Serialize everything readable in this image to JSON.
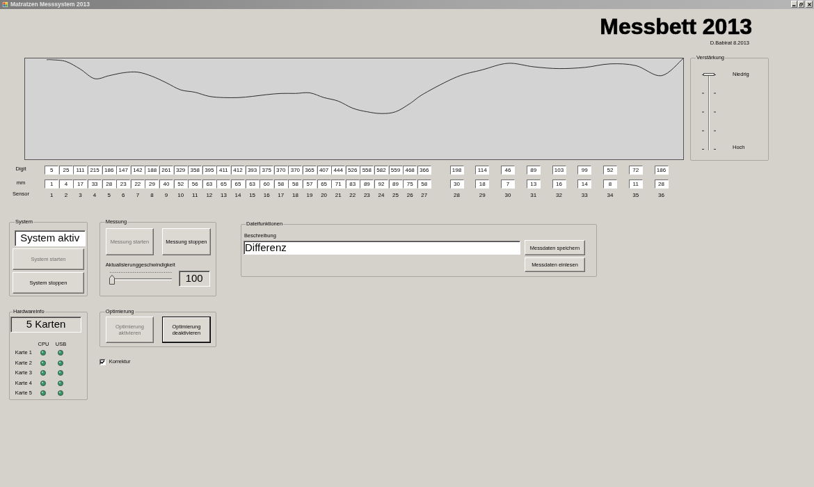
{
  "window": {
    "title": "Matratzen Messsystem 2013"
  },
  "header": {
    "title": "Messbett 2013",
    "subtitle": "D.Babirat 8.2013"
  },
  "gain": {
    "title": "Verstärkung",
    "level": 0,
    "top_label": "Niedrig",
    "bottom_label": "Hoch"
  },
  "sensor_table": {
    "row_labels": [
      "Digit",
      "mm",
      "Sensor"
    ],
    "groups": [
      {
        "kind": "dense",
        "sensors": [
          {
            "number": "1",
            "digit": "5",
            "mm": "1"
          },
          {
            "number": "2",
            "digit": "25",
            "mm": "4"
          },
          {
            "number": "3",
            "digit": "111",
            "mm": "17"
          },
          {
            "number": "4",
            "digit": "215",
            "mm": "33"
          },
          {
            "number": "5",
            "digit": "186",
            "mm": "28"
          },
          {
            "number": "6",
            "digit": "147",
            "mm": "23"
          },
          {
            "number": "7",
            "digit": "142",
            "mm": "22"
          },
          {
            "number": "8",
            "digit": "188",
            "mm": "29"
          },
          {
            "number": "9",
            "digit": "261",
            "mm": "40"
          },
          {
            "number": "10",
            "digit": "329",
            "mm": "52"
          },
          {
            "number": "11",
            "digit": "358",
            "mm": "56"
          },
          {
            "number": "12",
            "digit": "395",
            "mm": "63"
          },
          {
            "number": "13",
            "digit": "411",
            "mm": "65"
          },
          {
            "number": "14",
            "digit": "412",
            "mm": "65"
          },
          {
            "number": "15",
            "digit": "393",
            "mm": "63"
          },
          {
            "number": "16",
            "digit": "375",
            "mm": "60"
          },
          {
            "number": "17",
            "digit": "370",
            "mm": "58"
          },
          {
            "number": "18",
            "digit": "370",
            "mm": "58"
          },
          {
            "number": "19",
            "digit": "365",
            "mm": "57"
          },
          {
            "number": "20",
            "digit": "407",
            "mm": "65"
          },
          {
            "number": "21",
            "digit": "444",
            "mm": "71"
          },
          {
            "number": "22",
            "digit": "526",
            "mm": "83"
          },
          {
            "number": "23",
            "digit": "558",
            "mm": "89"
          },
          {
            "number": "24",
            "digit": "582",
            "mm": "92"
          },
          {
            "number": "25",
            "digit": "559",
            "mm": "89"
          },
          {
            "number": "26",
            "digit": "468",
            "mm": "75"
          },
          {
            "number": "27",
            "digit": "366",
            "mm": "58"
          }
        ]
      },
      {
        "kind": "spaced",
        "sensors": [
          {
            "number": "28",
            "digit": "198",
            "mm": "30"
          },
          {
            "number": "29",
            "digit": "114",
            "mm": "18"
          },
          {
            "number": "30",
            "digit": "46",
            "mm": "7"
          },
          {
            "number": "31",
            "digit": "89",
            "mm": "13"
          },
          {
            "number": "32",
            "digit": "103",
            "mm": "16"
          },
          {
            "number": "33",
            "digit": "99",
            "mm": "14"
          },
          {
            "number": "34",
            "digit": "52",
            "mm": "8"
          },
          {
            "number": "35",
            "digit": "72",
            "mm": "11"
          },
          {
            "number": "36",
            "digit": "186",
            "mm": "28"
          }
        ]
      }
    ]
  },
  "system": {
    "title": "System",
    "status_field": {
      "value": "System aktiv",
      "readonly": false
    },
    "buttons": [
      {
        "label": "System starten",
        "disabled": true
      },
      {
        "label": "System stoppen",
        "disabled": false
      }
    ]
  },
  "measurement": {
    "title": "Messung",
    "buttons": [
      {
        "label": "Messung starten",
        "disabled": true
      },
      {
        "label": "Messung stoppen",
        "disabled": false
      }
    ],
    "speed": {
      "label": "Aktualisierunggeschwindigkeit",
      "level": 0,
      "value_field": {
        "value": "100",
        "readonly": true
      }
    }
  },
  "hardware": {
    "title": "Hardwareinfo",
    "summary_field": {
      "value": "5 Karten",
      "readonly": true
    },
    "columns": [
      "CPU",
      "USB"
    ],
    "cards": [
      {
        "label": "Karte 1",
        "cpu_active": true,
        "usb_active": true
      },
      {
        "label": "Karte 2",
        "cpu_active": true,
        "usb_active": true
      },
      {
        "label": "Karte 3",
        "cpu_active": true,
        "usb_active": true
      },
      {
        "label": "Karte 4",
        "cpu_active": true,
        "usb_active": true
      },
      {
        "label": "Karte 5",
        "cpu_active": true,
        "usb_active": true
      }
    ]
  },
  "optimization": {
    "title": "Optimierung",
    "buttons": [
      {
        "label": "Optimierung aktivieren",
        "disabled": true,
        "focused": false
      },
      {
        "label": "Optimierung deaktivieren",
        "disabled": false,
        "focused": true
      }
    ]
  },
  "correction": {
    "label": "Korrektur",
    "checked": true
  },
  "file_functions": {
    "title": "Dateifunktionen",
    "description_label": "Beschreibung",
    "description_value": "Differenz",
    "buttons": [
      {
        "label": "Messdaten speichern"
      },
      {
        "label": "Messdaten einlesen"
      }
    ]
  }
}
